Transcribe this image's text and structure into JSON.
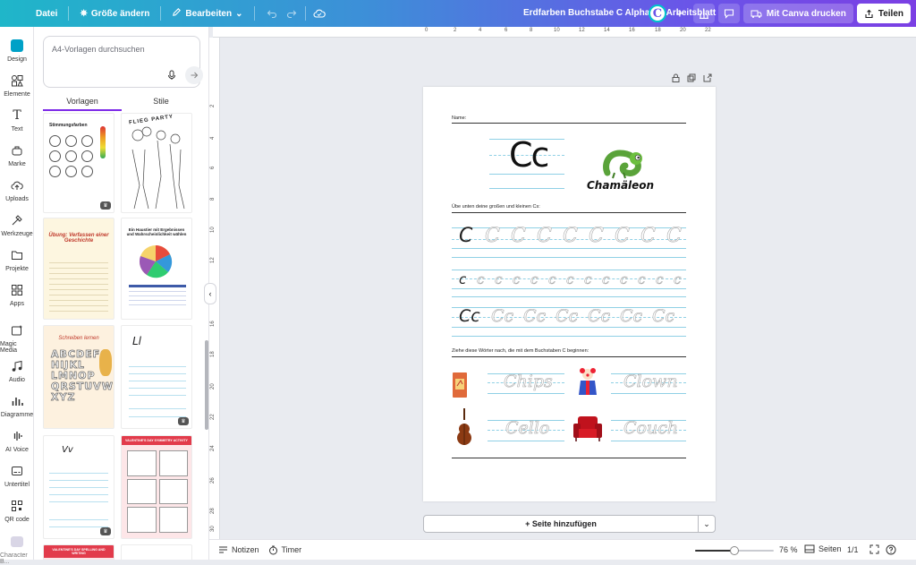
{
  "topbar": {
    "file_label": "Datei",
    "resize_label": "Größe ändern",
    "edit_label": "Bearbeiten",
    "doc_title": "Erdfarben Buchstabe C Alphabet-Arbeitsblatt",
    "avatar_initial": "C",
    "print_label": "Mit Canva drucken",
    "share_label": "Teilen"
  },
  "rail": {
    "items": [
      {
        "label": "Design",
        "icon": "design-icon"
      },
      {
        "label": "Elemente",
        "icon": "elements-icon"
      },
      {
        "label": "Text",
        "icon": "text-icon"
      },
      {
        "label": "Marke",
        "icon": "brand-icon"
      },
      {
        "label": "Uploads",
        "icon": "upload-icon"
      },
      {
        "label": "Werkzeuge",
        "icon": "tools-icon"
      },
      {
        "label": "Projekte",
        "icon": "folder-icon"
      },
      {
        "label": "Apps",
        "icon": "apps-icon"
      },
      {
        "label": "Magic Media",
        "icon": "magic-media-icon"
      },
      {
        "label": "Audio",
        "icon": "audio-icon"
      },
      {
        "label": "Diagramme",
        "icon": "chart-icon"
      },
      {
        "label": "AI Voice",
        "icon": "ai-voice-icon"
      },
      {
        "label": "Untertitel",
        "icon": "subtitles-icon"
      },
      {
        "label": "QR code",
        "icon": "qr-code-icon"
      },
      {
        "label": "Character B...",
        "icon": "character-icon"
      }
    ]
  },
  "panel": {
    "search_placeholder": "A4-Vorlagen durchsuchen",
    "tabs": [
      "Vorlagen",
      "Stile"
    ],
    "active_tab": "Vorlagen",
    "thumbs": [
      {
        "title": "Stimmungsfarben"
      },
      {
        "title": "FLIEG PARTY"
      },
      {
        "title": "Übung: Verfassen einer Geschichte"
      },
      {
        "title": "Ein Haustier mit Ergebnissen und Wahrscheinlichkeit wählen"
      },
      {
        "title": "Schreiben lernen"
      },
      {
        "title": "Ll"
      },
      {
        "title": "Vv"
      },
      {
        "title": "VALENTINE'S DAY SYMMETRY ACTIVITY"
      },
      {
        "title": "VALENTINE'S DAY SPELLING AND WRITING"
      },
      {
        "title": ""
      }
    ]
  },
  "ruler": {
    "h_labels": [
      "0",
      "2",
      "4",
      "6",
      "8",
      "10",
      "12",
      "14",
      "16",
      "18",
      "20",
      "22"
    ],
    "v_labels": [
      "2",
      "4",
      "6",
      "8",
      "10",
      "12",
      "14",
      "16",
      "18",
      "20",
      "22",
      "24",
      "26",
      "28",
      "30"
    ]
  },
  "worksheet": {
    "name_label": "Name:",
    "big_letters": "Cc",
    "animal_word": "Chamäleon",
    "instruction_1": "Übe unten deine großen und kleinen Cs:",
    "row_upper": "C",
    "row_lower": "c",
    "row_mixed": "Cc",
    "instruction_2": "Ziehe diese Wörter nach, die mit dem Buchstaben C beginnen:",
    "words": [
      "Chips",
      "Clown",
      "Cello",
      "Couch"
    ],
    "accent_color": "#8fd0e5"
  },
  "add_page_label": "+ Seite hinzufügen",
  "footer": {
    "notes_label": "Notizen",
    "timer_label": "Timer",
    "zoom": "76 %",
    "pages_label": "Seiten",
    "page_count": "1/1",
    "zoom_fraction": 0.5
  }
}
